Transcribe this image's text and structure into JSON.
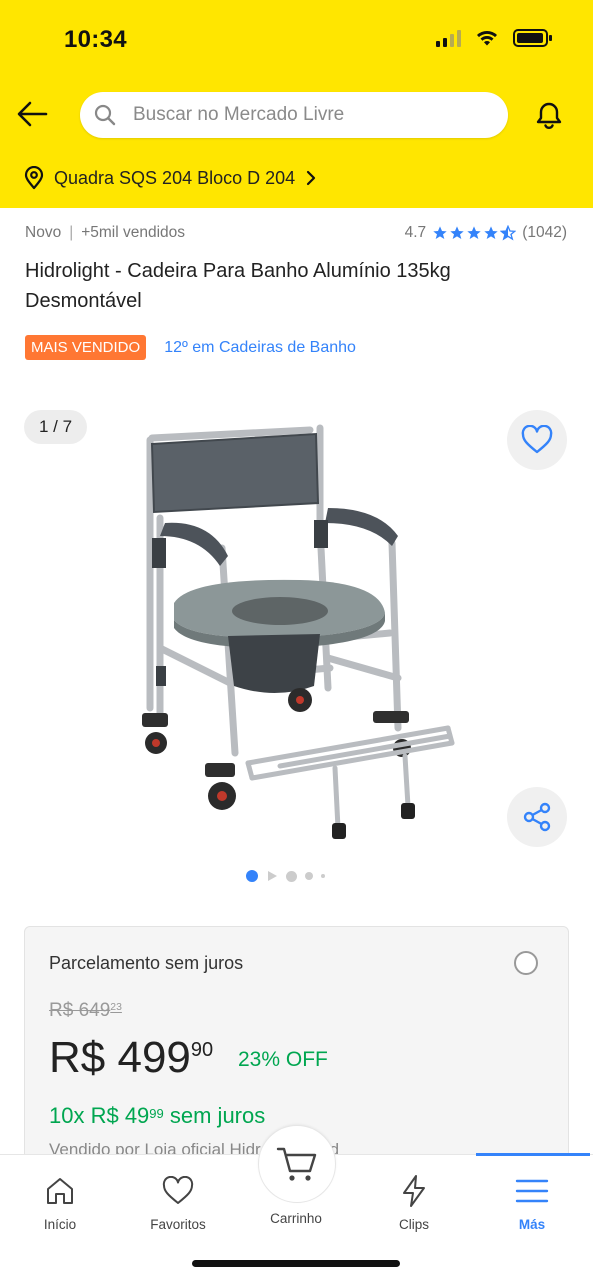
{
  "status_bar": {
    "time": "10:34"
  },
  "header": {
    "search_placeholder": "Buscar no Mercado Livre",
    "address": "Quadra SQS 204 Bloco D 204"
  },
  "product": {
    "condition": "Novo",
    "sold_count": "+5mil vendidos",
    "rating": "4.7",
    "rating_stars": 4.5,
    "reviews_count": "(1042)",
    "title": "Hidrolight - Cadeira Para Banho Alumínio 135kg Desmontável",
    "badge_best_seller": "MAIS VENDIDO",
    "ranking": "12º em Cadeiras de Banho",
    "image_alt_icon": "shower-commode-chair-image",
    "gallery_counter": "1 / 7",
    "gallery_position": 1,
    "gallery_total": 7
  },
  "price_card": {
    "title": "Parcelamento sem juros",
    "old_price_int": "R$ 649",
    "old_price_cents": "23",
    "price_int": "R$ 499",
    "price_cents": "90",
    "discount": "23% OFF",
    "installments_prefix": "10x R$ 49",
    "installments_cents": "99",
    "installments_suffix": " sem juros",
    "sold_by": "Vendido por Loja oficial Hidrolight med"
  },
  "bottom_nav": {
    "items": [
      {
        "label": "Início",
        "icon": "home-icon"
      },
      {
        "label": "Favoritos",
        "icon": "heart-icon"
      },
      {
        "label": "Carrinho",
        "icon": "cart-icon"
      },
      {
        "label": "Clips",
        "icon": "lightning-icon"
      },
      {
        "label": "Más",
        "icon": "menu-icon"
      }
    ],
    "active_index": 4
  },
  "colors": {
    "header_yellow": "#ffe600",
    "accent_blue": "#3483fa",
    "green": "#00a650",
    "badge_orange": "#ff7733"
  }
}
